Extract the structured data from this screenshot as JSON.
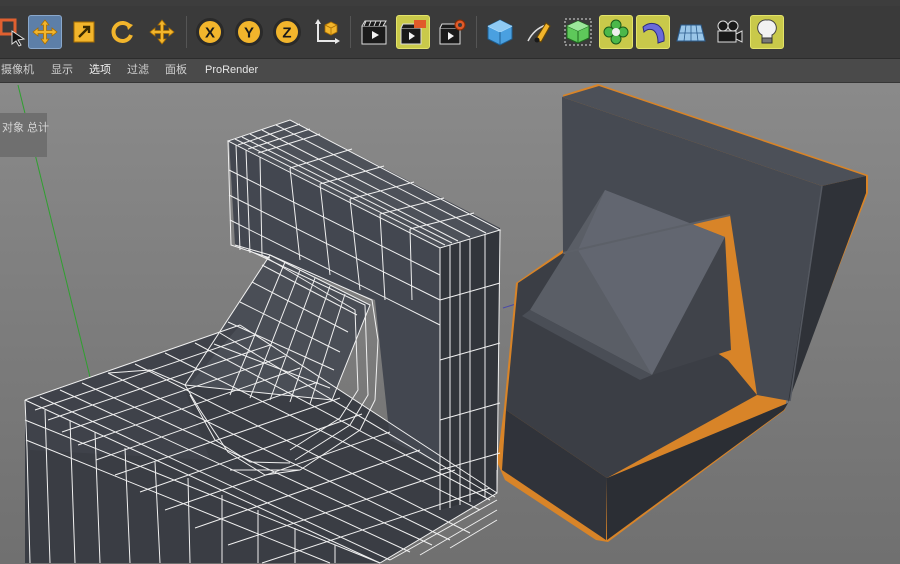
{
  "toolbar": {
    "buttons": [
      {
        "name": "live-selection-icon"
      },
      {
        "name": "move-tool-icon"
      },
      {
        "name": "scale-tool-icon"
      },
      {
        "name": "rotate-tool-icon"
      },
      {
        "name": "transform-tool-icon"
      },
      {
        "name": "x-axis-lock-icon",
        "label": "X"
      },
      {
        "name": "y-axis-lock-icon",
        "label": "Y"
      },
      {
        "name": "z-axis-lock-icon",
        "label": "Z"
      },
      {
        "name": "coordinate-system-icon"
      },
      {
        "name": "render-view-icon"
      },
      {
        "name": "render-picture-viewer-icon"
      },
      {
        "name": "render-settings-icon"
      },
      {
        "name": "cube-primitive-icon"
      },
      {
        "name": "pen-spline-icon"
      },
      {
        "name": "subdivision-generator-icon"
      },
      {
        "name": "cloner-mograph-icon"
      },
      {
        "name": "bend-deformer-icon"
      },
      {
        "name": "floor-scene-icon"
      },
      {
        "name": "camera-icon"
      },
      {
        "name": "light-icon"
      }
    ]
  },
  "view_menu": {
    "items": [
      "摄像机",
      "显示",
      "选项",
      "过滤",
      "面板",
      "ProRender"
    ]
  },
  "hud": {
    "label": "对象 总计"
  },
  "colors": {
    "active_tool": "#5d7fa8",
    "highlight_tool": "#c9c94a",
    "selection_outline": "#e08a2a",
    "y_axis": "#2fa02f"
  }
}
